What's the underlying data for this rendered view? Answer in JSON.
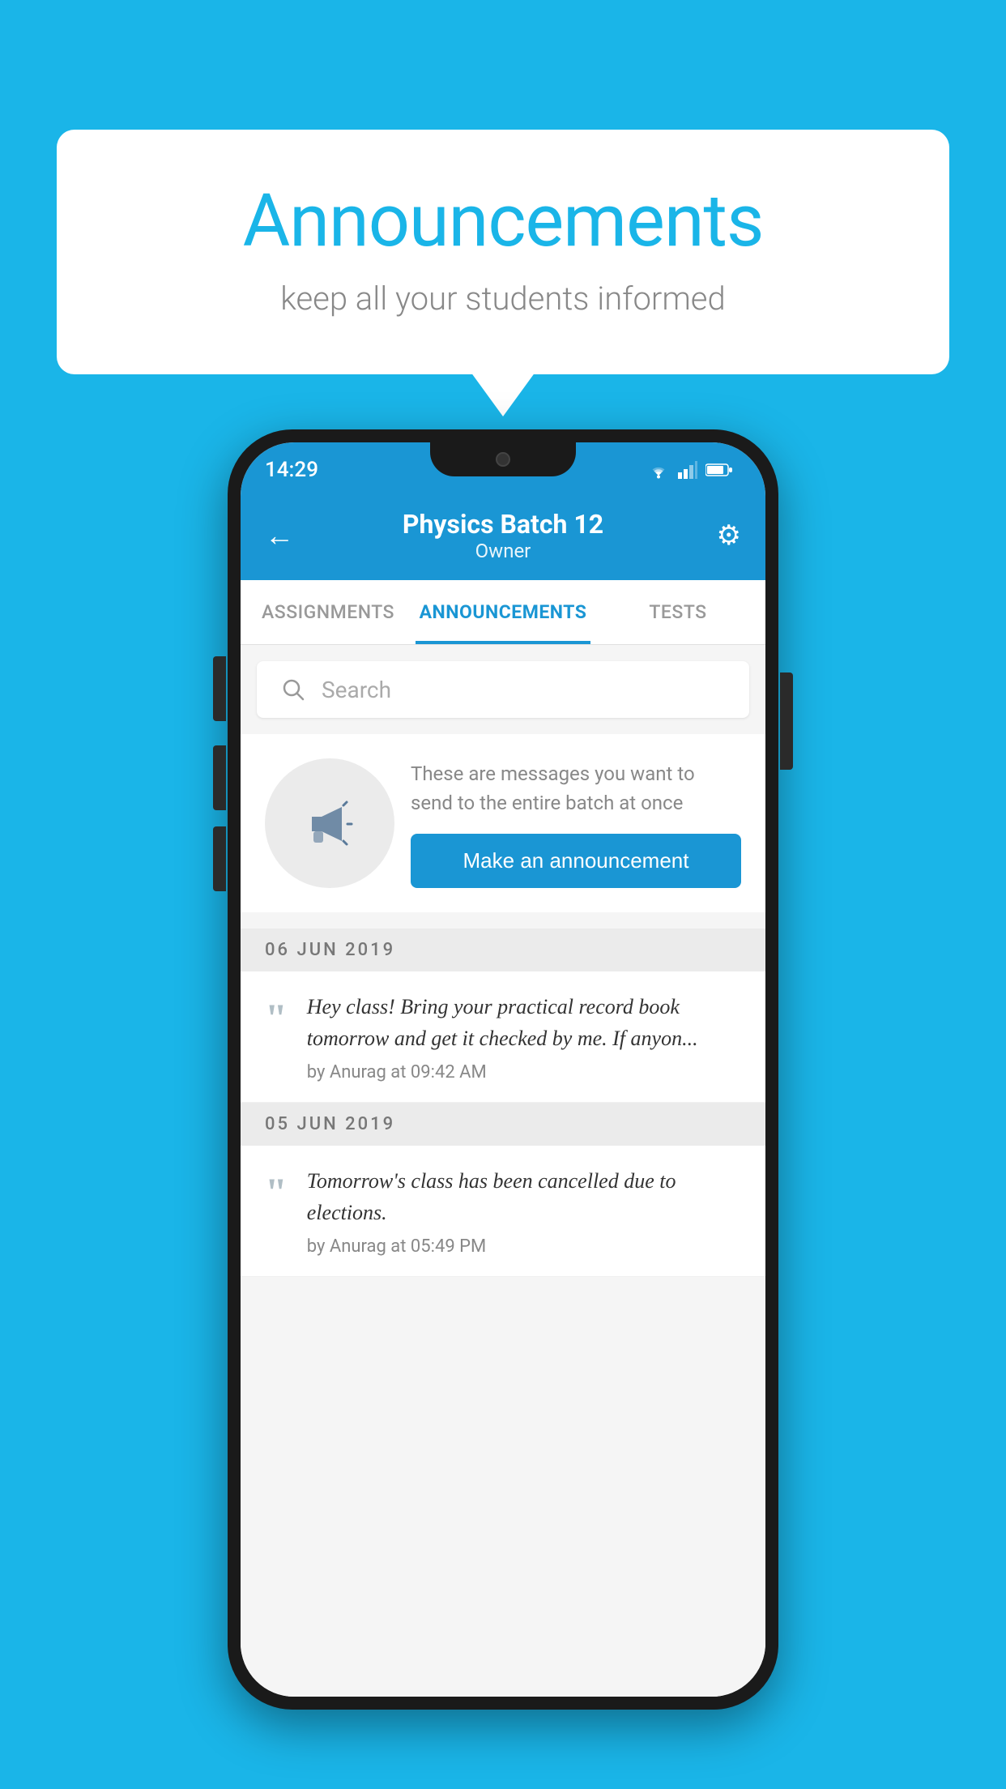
{
  "background_color": "#1ab5e8",
  "speech_bubble": {
    "title": "Announcements",
    "subtitle": "keep all your students informed"
  },
  "phone": {
    "status_bar": {
      "time": "14:29"
    },
    "header": {
      "title": "Physics Batch 12",
      "subtitle": "Owner",
      "back_label": "←",
      "settings_label": "⚙"
    },
    "tabs": [
      {
        "label": "ASSIGNMENTS",
        "active": false
      },
      {
        "label": "ANNOUNCEMENTS",
        "active": true
      },
      {
        "label": "TESTS",
        "active": false
      },
      {
        "label": "•••",
        "active": false
      }
    ],
    "search": {
      "placeholder": "Search"
    },
    "promo": {
      "description": "These are messages you want to send to the entire batch at once",
      "button_label": "Make an announcement"
    },
    "announcements": [
      {
        "date": "06  JUN  2019",
        "items": [
          {
            "text": "Hey class! Bring your practical record book tomorrow and get it checked by me. If anyon...",
            "meta": "by Anurag at 09:42 AM"
          }
        ]
      },
      {
        "date": "05  JUN  2019",
        "items": [
          {
            "text": "Tomorrow's class has been cancelled due to elections.",
            "meta": "by Anurag at 05:49 PM"
          }
        ]
      }
    ]
  }
}
